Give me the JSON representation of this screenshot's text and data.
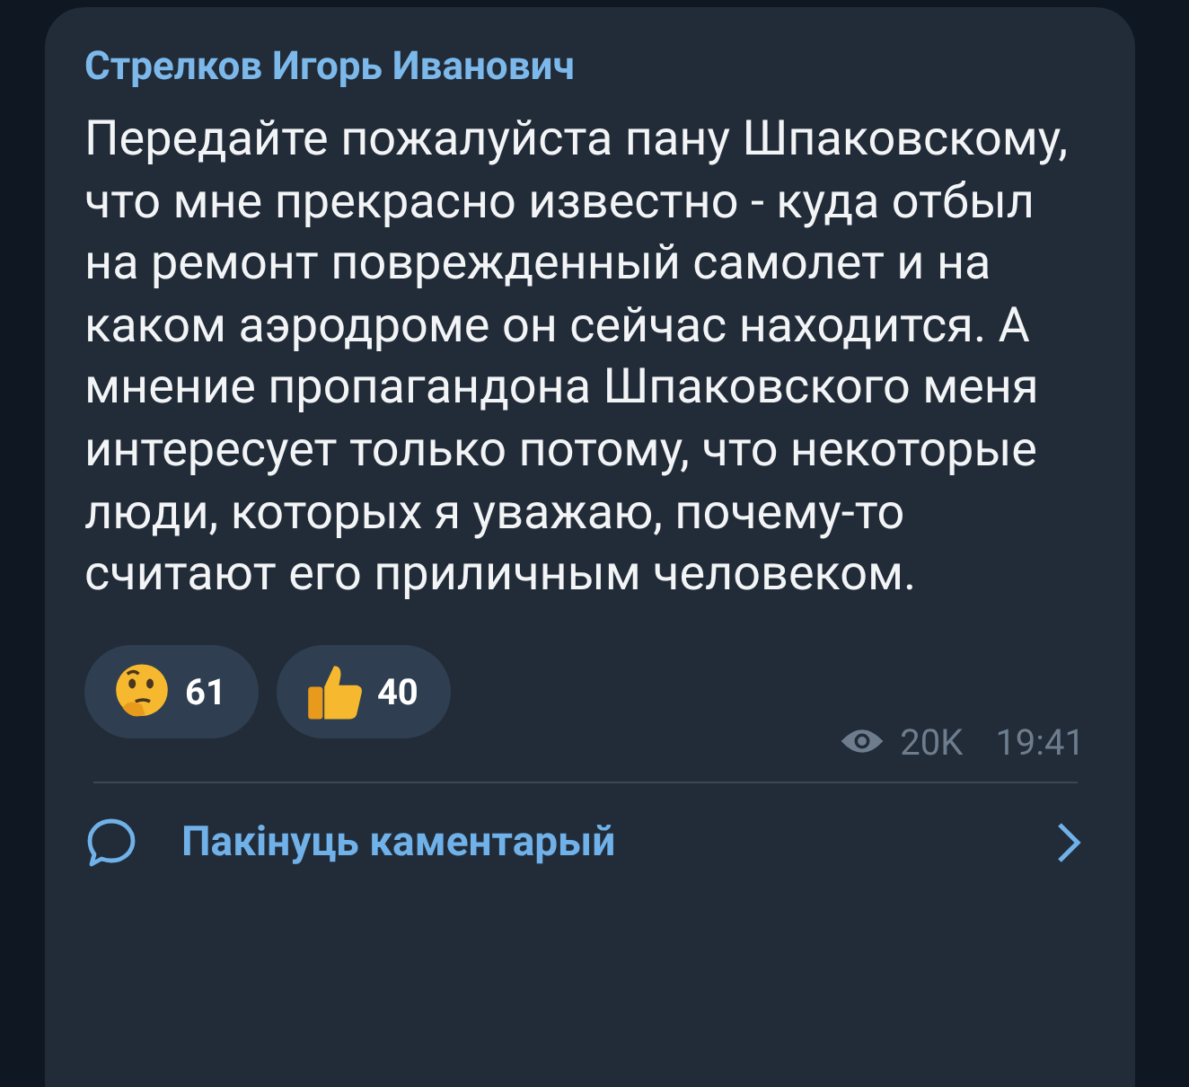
{
  "message": {
    "author": "Стрелков Игорь Иванович",
    "text": "Передайте пожалуйста пану Шпаковскому, что мне прекрасно известно - куда отбыл на ремонт поврежденный самолет и на каком аэродроме он сейчас находится. А мнение пропагандона Шпаковского меня интересует только потому, что некоторые люди, которых я уважаю, почему-то считают его приличным человеком.",
    "reactions": [
      {
        "kind": "thinking",
        "count": "61"
      },
      {
        "kind": "thumbs_up",
        "count": "40"
      }
    ],
    "views": "20K",
    "time": "19:41"
  },
  "comment_button": {
    "label": "Пакінуць каментарый"
  }
}
